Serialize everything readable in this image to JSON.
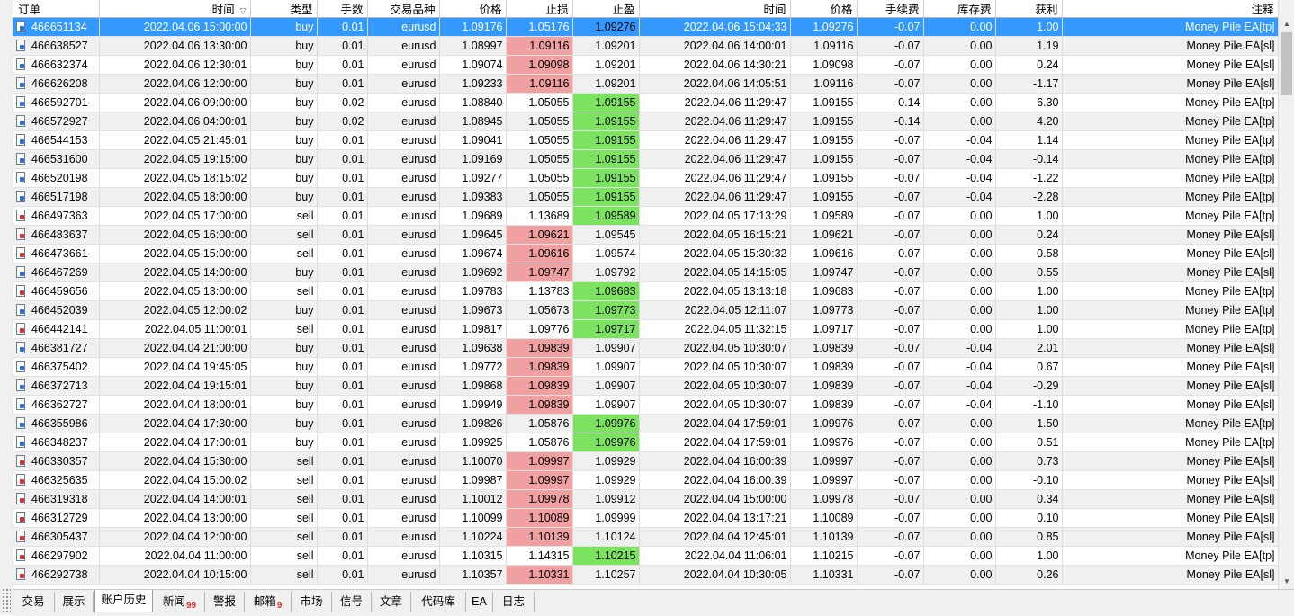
{
  "columns": [
    "订单",
    "时间",
    "类型",
    "手数",
    "交易品种",
    "价格",
    "止损",
    "止盈",
    "时间",
    "价格",
    "手续费",
    "库存费",
    "获利",
    "注释"
  ],
  "sort_indicator": "▽",
  "selected_row": 0,
  "rows": [
    [
      "466651134",
      "2022.04.06 15:00:00",
      "buy",
      "0.01",
      "eurusd",
      "1.09176",
      "1.05176",
      "1.09276",
      "2022.04.06 15:04:33",
      "1.09276",
      "-0.07",
      "0.00",
      "1.00",
      "Money Pile EA[tp]"
    ],
    [
      "466638527",
      "2022.04.06 13:30:00",
      "buy",
      "0.01",
      "eurusd",
      "1.08997",
      "1.09116",
      "1.09201",
      "2022.04.06 14:00:01",
      "1.09116",
      "-0.07",
      "0.00",
      "1.19",
      "Money Pile EA[sl]"
    ],
    [
      "466632374",
      "2022.04.06 12:30:01",
      "buy",
      "0.01",
      "eurusd",
      "1.09074",
      "1.09098",
      "1.09201",
      "2022.04.06 14:30:21",
      "1.09098",
      "-0.07",
      "0.00",
      "0.24",
      "Money Pile EA[sl]"
    ],
    [
      "466626208",
      "2022.04.06 12:00:00",
      "buy",
      "0.01",
      "eurusd",
      "1.09233",
      "1.09116",
      "1.09201",
      "2022.04.06 14:05:51",
      "1.09116",
      "-0.07",
      "0.00",
      "-1.17",
      "Money Pile EA[sl]"
    ],
    [
      "466592701",
      "2022.04.06 09:00:00",
      "buy",
      "0.02",
      "eurusd",
      "1.08840",
      "1.05055",
      "1.09155",
      "2022.04.06 11:29:47",
      "1.09155",
      "-0.14",
      "0.00",
      "6.30",
      "Money Pile EA[tp]"
    ],
    [
      "466572927",
      "2022.04.06 04:00:01",
      "buy",
      "0.02",
      "eurusd",
      "1.08945",
      "1.05055",
      "1.09155",
      "2022.04.06 11:29:47",
      "1.09155",
      "-0.14",
      "0.00",
      "4.20",
      "Money Pile EA[tp]"
    ],
    [
      "466544153",
      "2022.04.05 21:45:01",
      "buy",
      "0.01",
      "eurusd",
      "1.09041",
      "1.05055",
      "1.09155",
      "2022.04.06 11:29:47",
      "1.09155",
      "-0.07",
      "-0.04",
      "1.14",
      "Money Pile EA[tp]"
    ],
    [
      "466531600",
      "2022.04.05 19:15:00",
      "buy",
      "0.01",
      "eurusd",
      "1.09169",
      "1.05055",
      "1.09155",
      "2022.04.06 11:29:47",
      "1.09155",
      "-0.07",
      "-0.04",
      "-0.14",
      "Money Pile EA[tp]"
    ],
    [
      "466520198",
      "2022.04.05 18:15:02",
      "buy",
      "0.01",
      "eurusd",
      "1.09277",
      "1.05055",
      "1.09155",
      "2022.04.06 11:29:47",
      "1.09155",
      "-0.07",
      "-0.04",
      "-1.22",
      "Money Pile EA[tp]"
    ],
    [
      "466517198",
      "2022.04.05 18:00:00",
      "buy",
      "0.01",
      "eurusd",
      "1.09383",
      "1.05055",
      "1.09155",
      "2022.04.06 11:29:47",
      "1.09155",
      "-0.07",
      "-0.04",
      "-2.28",
      "Money Pile EA[tp]"
    ],
    [
      "466497363",
      "2022.04.05 17:00:00",
      "sell",
      "0.01",
      "eurusd",
      "1.09689",
      "1.13689",
      "1.09589",
      "2022.04.05 17:13:29",
      "1.09589",
      "-0.07",
      "0.00",
      "1.00",
      "Money Pile EA[tp]"
    ],
    [
      "466483637",
      "2022.04.05 16:00:00",
      "sell",
      "0.01",
      "eurusd",
      "1.09645",
      "1.09621",
      "1.09545",
      "2022.04.05 16:15:21",
      "1.09621",
      "-0.07",
      "0.00",
      "0.24",
      "Money Pile EA[sl]"
    ],
    [
      "466473661",
      "2022.04.05 15:00:00",
      "sell",
      "0.01",
      "eurusd",
      "1.09674",
      "1.09616",
      "1.09574",
      "2022.04.05 15:30:32",
      "1.09616",
      "-0.07",
      "0.00",
      "0.58",
      "Money Pile EA[sl]"
    ],
    [
      "466467269",
      "2022.04.05 14:00:00",
      "buy",
      "0.01",
      "eurusd",
      "1.09692",
      "1.09747",
      "1.09792",
      "2022.04.05 14:15:05",
      "1.09747",
      "-0.07",
      "0.00",
      "0.55",
      "Money Pile EA[sl]"
    ],
    [
      "466459656",
      "2022.04.05 13:00:00",
      "sell",
      "0.01",
      "eurusd",
      "1.09783",
      "1.13783",
      "1.09683",
      "2022.04.05 13:13:18",
      "1.09683",
      "-0.07",
      "0.00",
      "1.00",
      "Money Pile EA[tp]"
    ],
    [
      "466452039",
      "2022.04.05 12:00:02",
      "buy",
      "0.01",
      "eurusd",
      "1.09673",
      "1.05673",
      "1.09773",
      "2022.04.05 12:11:07",
      "1.09773",
      "-0.07",
      "0.00",
      "1.00",
      "Money Pile EA[tp]"
    ],
    [
      "466442141",
      "2022.04.05 11:00:01",
      "sell",
      "0.01",
      "eurusd",
      "1.09817",
      "1.09776",
      "1.09717",
      "2022.04.05 11:32:15",
      "1.09717",
      "-0.07",
      "0.00",
      "1.00",
      "Money Pile EA[tp]"
    ],
    [
      "466381727",
      "2022.04.04 21:00:00",
      "buy",
      "0.01",
      "eurusd",
      "1.09638",
      "1.09839",
      "1.09907",
      "2022.04.05 10:30:07",
      "1.09839",
      "-0.07",
      "-0.04",
      "2.01",
      "Money Pile EA[sl]"
    ],
    [
      "466375402",
      "2022.04.04 19:45:05",
      "buy",
      "0.01",
      "eurusd",
      "1.09772",
      "1.09839",
      "1.09907",
      "2022.04.05 10:30:07",
      "1.09839",
      "-0.07",
      "-0.04",
      "0.67",
      "Money Pile EA[sl]"
    ],
    [
      "466372713",
      "2022.04.04 19:15:01",
      "buy",
      "0.01",
      "eurusd",
      "1.09868",
      "1.09839",
      "1.09907",
      "2022.04.05 10:30:07",
      "1.09839",
      "-0.07",
      "-0.04",
      "-0.29",
      "Money Pile EA[sl]"
    ],
    [
      "466362727",
      "2022.04.04 18:00:01",
      "buy",
      "0.01",
      "eurusd",
      "1.09949",
      "1.09839",
      "1.09907",
      "2022.04.05 10:30:07",
      "1.09839",
      "-0.07",
      "-0.04",
      "-1.10",
      "Money Pile EA[sl]"
    ],
    [
      "466355986",
      "2022.04.04 17:30:00",
      "buy",
      "0.01",
      "eurusd",
      "1.09826",
      "1.05876",
      "1.09976",
      "2022.04.04 17:59:01",
      "1.09976",
      "-0.07",
      "0.00",
      "1.50",
      "Money Pile EA[tp]"
    ],
    [
      "466348237",
      "2022.04.04 17:00:01",
      "buy",
      "0.01",
      "eurusd",
      "1.09925",
      "1.05876",
      "1.09976",
      "2022.04.04 17:59:01",
      "1.09976",
      "-0.07",
      "0.00",
      "0.51",
      "Money Pile EA[tp]"
    ],
    [
      "466330357",
      "2022.04.04 15:30:00",
      "sell",
      "0.01",
      "eurusd",
      "1.10070",
      "1.09997",
      "1.09929",
      "2022.04.04 16:00:39",
      "1.09997",
      "-0.07",
      "0.00",
      "0.73",
      "Money Pile EA[sl]"
    ],
    [
      "466325635",
      "2022.04.04 15:00:02",
      "sell",
      "0.01",
      "eurusd",
      "1.09987",
      "1.09997",
      "1.09929",
      "2022.04.04 16:00:39",
      "1.09997",
      "-0.07",
      "0.00",
      "-0.10",
      "Money Pile EA[sl]"
    ],
    [
      "466319318",
      "2022.04.04 14:00:01",
      "sell",
      "0.01",
      "eurusd",
      "1.10012",
      "1.09978",
      "1.09912",
      "2022.04.04 15:00:00",
      "1.09978",
      "-0.07",
      "0.00",
      "0.34",
      "Money Pile EA[sl]"
    ],
    [
      "466312729",
      "2022.04.04 13:00:00",
      "sell",
      "0.01",
      "eurusd",
      "1.10099",
      "1.10089",
      "1.09999",
      "2022.04.04 13:17:21",
      "1.10089",
      "-0.07",
      "0.00",
      "0.10",
      "Money Pile EA[sl]"
    ],
    [
      "466305437",
      "2022.04.04 12:00:00",
      "sell",
      "0.01",
      "eurusd",
      "1.10224",
      "1.10139",
      "1.10124",
      "2022.04.04 12:45:01",
      "1.10139",
      "-0.07",
      "0.00",
      "0.85",
      "Money Pile EA[sl]"
    ],
    [
      "466297902",
      "2022.04.04 11:00:00",
      "sell",
      "0.01",
      "eurusd",
      "1.10315",
      "1.14315",
      "1.10215",
      "2022.04.04 11:06:01",
      "1.10215",
      "-0.07",
      "0.00",
      "1.00",
      "Money Pile EA[tp]"
    ],
    [
      "466292738",
      "2022.04.04 10:15:00",
      "sell",
      "0.01",
      "eurusd",
      "1.10357",
      "1.10331",
      "1.10257",
      "2022.04.04 10:30:05",
      "1.10331",
      "-0.07",
      "0.00",
      "0.26",
      "Money Pile EA[sl]"
    ]
  ],
  "highlights": {
    "sl_hit_color": "#f0a0a0",
    "tp_hit_color": "#7be35f",
    "selection_color": "#3399ff"
  },
  "tabs": [
    {
      "label": "交易",
      "badge": ""
    },
    {
      "label": "展示",
      "badge": ""
    },
    {
      "label": "账户历史",
      "badge": "",
      "active": true
    },
    {
      "label": "新闻",
      "badge": "99"
    },
    {
      "label": "警报",
      "badge": ""
    },
    {
      "label": "邮箱",
      "badge": "9"
    },
    {
      "label": "市场",
      "badge": ""
    },
    {
      "label": "信号",
      "badge": ""
    },
    {
      "label": "文章",
      "badge": ""
    },
    {
      "label": "代码库",
      "badge": ""
    },
    {
      "label": "EA",
      "badge": ""
    },
    {
      "label": "日志",
      "badge": ""
    }
  ],
  "icons": {
    "buy_order": "document-blue-icon",
    "sell_order": "document-red-icon",
    "scroll_up": "scroll-up-arrow-icon",
    "scroll_down": "scroll-down-arrow-icon"
  }
}
